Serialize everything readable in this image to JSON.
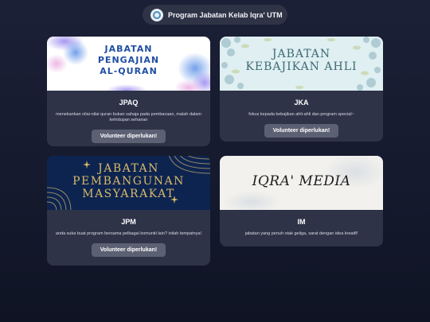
{
  "header": {
    "title": "Program Jabatan Kelab Iqra' UTM",
    "logo": "iqra-logo-icon"
  },
  "cards": [
    {
      "banner_lines": [
        "JABATAN",
        "PENGAJIAN",
        "AL-QURAN"
      ],
      "code": "JPAQ",
      "description": "menekankan nilai-nilai quran bukan sahaja pada pembacaan, malah dalam kehidupan seharian",
      "button_label": "Volunteer diperlukan!"
    },
    {
      "banner_lines": [
        "JABATAN",
        "KEBAJIKAN AHLI"
      ],
      "code": "JKA",
      "description": "fokus kepada kebajikan ahli-ahli dan program special~",
      "button_label": "Volunteer diperlukan!"
    },
    {
      "banner_lines": [
        "JABATAN",
        "PEMBANGUNAN",
        "MASYARAKAT"
      ],
      "code": "JPM",
      "description": "anda suka buat program bersama pelbagai komuniti lain? inilah tempatnya!",
      "button_label": "Volunteer diperlukan!"
    },
    {
      "banner_lines": [
        "IQRA' MEDIA"
      ],
      "code": "IM",
      "description": "jabatan yang penuh otak geliga, sarat dengan idea kreatif!"
    }
  ],
  "colors": {
    "background": "#1a1e33",
    "card": "#2e3348",
    "button": "#5c6073",
    "jpaq_text": "#1f4ea3",
    "jpm_gold": "#d9b96a",
    "jpm_navy": "#0d2450"
  }
}
